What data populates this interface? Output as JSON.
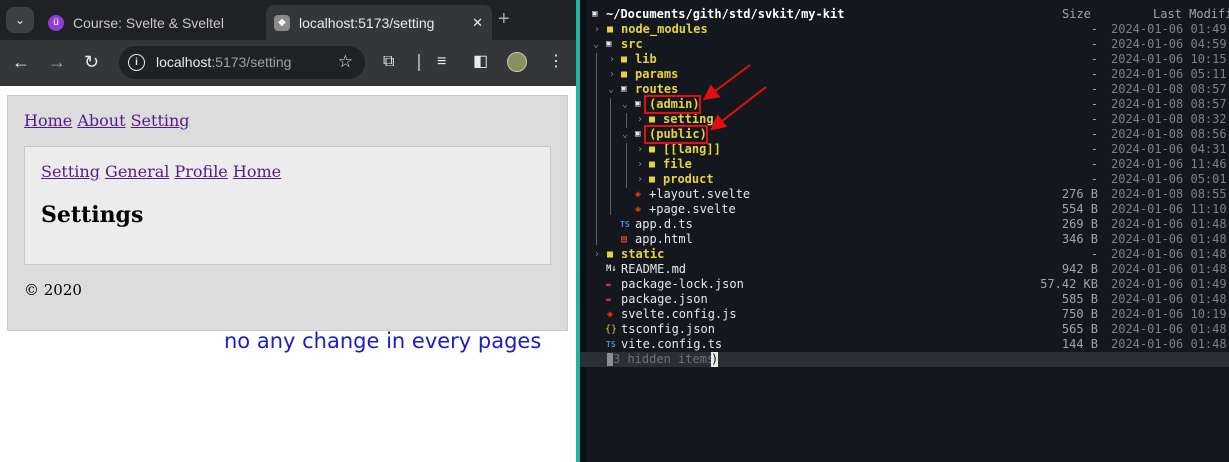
{
  "browser": {
    "tabs": [
      {
        "title": "Course: Svelte & Sveltel",
        "icon": "svelte-favicon-icon",
        "active": false
      },
      {
        "title": "localhost:5173/setting",
        "icon": "page-favicon-icon",
        "active": true
      }
    ],
    "url_host": "localhost",
    "url_rest": ":5173/setting",
    "page": {
      "top_nav": [
        "Home",
        "About",
        "Setting"
      ],
      "sub_nav": [
        "Setting",
        "General",
        "Profile",
        "Home"
      ],
      "heading": "Settings",
      "footer": "© 2020"
    }
  },
  "annotation_note": "no any change in every pages",
  "terminal": {
    "header": {
      "path": "~/Documents/gith/std/svkit/my-kit",
      "size_col": "Size",
      "modified_col": "Last Modifi"
    },
    "rows": [
      {
        "name": "node_modules",
        "type": "dir",
        "size": "-",
        "modified": "2024-01-06 01:49"
      },
      {
        "name": "src",
        "type": "dir-open",
        "size": "-",
        "modified": "2024-01-06 04:59"
      },
      {
        "name": "lib",
        "type": "dir",
        "size": "-",
        "modified": "2024-01-06 10:15"
      },
      {
        "name": "params",
        "type": "dir",
        "size": "-",
        "modified": "2024-01-06 05:11"
      },
      {
        "name": "routes",
        "type": "dir-open",
        "size": "-",
        "modified": "2024-01-08 08:57"
      },
      {
        "name": "(admin)",
        "type": "dir-open",
        "size": "-",
        "modified": "2024-01-08 08:57"
      },
      {
        "name": "setting",
        "type": "dir",
        "size": "-",
        "modified": "2024-01-08 08:32"
      },
      {
        "name": "(public)",
        "type": "dir-open",
        "size": "-",
        "modified": "2024-01-08 08:56"
      },
      {
        "name": "[[lang]]",
        "type": "dir",
        "size": "-",
        "modified": "2024-01-06 04:31"
      },
      {
        "name": "file",
        "type": "dir",
        "size": "-",
        "modified": "2024-01-06 11:46"
      },
      {
        "name": "product",
        "type": "dir",
        "size": "-",
        "modified": "2024-01-06 05:01"
      },
      {
        "name": "+layout.svelte",
        "type": "svelte",
        "size": "276 B",
        "modified": "2024-01-08 08:55"
      },
      {
        "name": "+page.svelte",
        "type": "svelte",
        "size": "554 B",
        "modified": "2024-01-06 11:10"
      },
      {
        "name": "app.d.ts",
        "type": "ts",
        "size": "269 B",
        "modified": "2024-01-06 01:48"
      },
      {
        "name": "app.html",
        "type": "html",
        "size": "346 B",
        "modified": "2024-01-06 01:48"
      },
      {
        "name": "static",
        "type": "dir",
        "size": "-",
        "modified": "2024-01-06 01:48"
      },
      {
        "name": "README.md",
        "type": "md",
        "size": "942 B",
        "modified": "2024-01-06 01:48"
      },
      {
        "name": "package-lock.json",
        "type": "npm",
        "size": "57.42 KB",
        "modified": "2024-01-06 01:49"
      },
      {
        "name": "package.json",
        "type": "npm",
        "size": "585 B",
        "modified": "2024-01-06 01:48"
      },
      {
        "name": "svelte.config.js",
        "type": "svelte",
        "size": "750 B",
        "modified": "2024-01-06 10:19"
      },
      {
        "name": "tsconfig.json",
        "type": "json",
        "size": "565 B",
        "modified": "2024-01-06 01:48"
      },
      {
        "name": "vite.config.ts",
        "type": "ts",
        "size": "144 B",
        "modified": "2024-01-06 01:48"
      }
    ],
    "hidden_items": "3 hidden items",
    "hidden_paren": ")"
  },
  "colors": {
    "annotation_red": "#e01010",
    "divider": "#24b3a3",
    "folder": "#e6d53a"
  }
}
